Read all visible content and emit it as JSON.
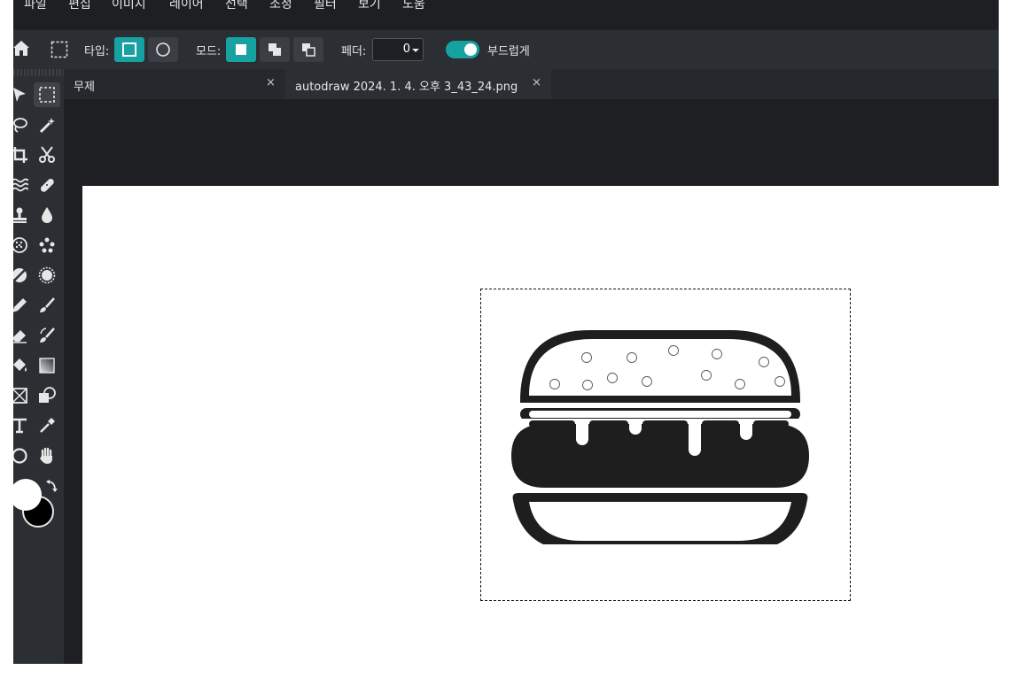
{
  "menu": [
    "파일",
    "편집",
    "이미지",
    "레이어",
    "선택",
    "조정",
    "필터",
    "보기",
    "도움"
  ],
  "toolbar": {
    "type_label": "타입:",
    "mode_label": "모드:",
    "feather_label": "페더:",
    "feather_value": "0",
    "smooth_label": "부드럽게",
    "smooth_on": true
  },
  "tabs": [
    {
      "label": "무제",
      "close": "×"
    },
    {
      "label": "autodraw 2024. 1. 4. 오후 3_43_24.png",
      "close": "×"
    }
  ],
  "tools": [
    "move-icon",
    "marquee-icon",
    "lasso-icon",
    "magic-wand-icon",
    "crop-icon",
    "scissors-icon",
    "liquify-icon",
    "bandage-icon",
    "stamp-icon",
    "blur-icon",
    "sponge-icon",
    "spot-icon",
    "dodge-icon",
    "sharpen-icon",
    "pencil-icon",
    "brush-icon",
    "eraser-icon",
    "color-replace-icon",
    "bucket-icon",
    "gradient-icon",
    "frame-icon",
    "shape-icon",
    "text-icon",
    "eyedropper-icon",
    "ellipse-icon",
    "hand-icon"
  ],
  "colors": {
    "accent": "#16a2a1",
    "foreground": "#ffffff",
    "background": "#000000"
  }
}
